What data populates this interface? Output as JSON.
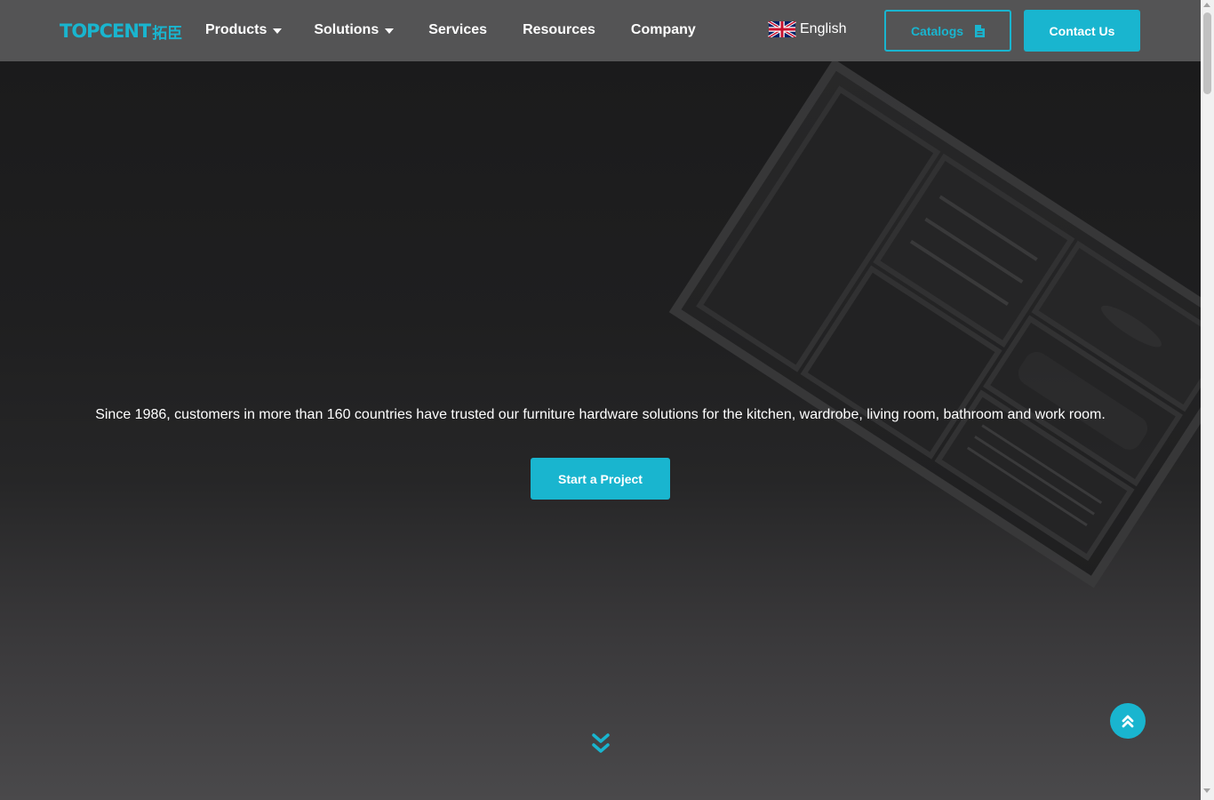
{
  "header": {
    "logo_text": "TOPCENT",
    "logo_text_cn": "拓臣",
    "nav": [
      {
        "label": "Products",
        "dropdown": true
      },
      {
        "label": "Solutions",
        "dropdown": true
      },
      {
        "label": "Services",
        "dropdown": false
      },
      {
        "label": "Resources",
        "dropdown": false
      },
      {
        "label": "Company",
        "dropdown": false
      }
    ],
    "language": {
      "label": "English",
      "icon": "uk-flag-icon"
    },
    "catalogs_label": "Catalogs",
    "catalogs_icon": "document-icon",
    "contact_label": "Contact Us"
  },
  "hero": {
    "tagline": "Since 1986, customers in more than 160 countries have trusted our furniture hardware solutions for the kitchen, wardrobe, living room, bathroom and work room.",
    "cta_label": "Start a Project",
    "scroll_icon": "double-chevron-down-icon"
  },
  "back_to_top_icon": "double-chevron-up-icon",
  "colors": {
    "accent": "#19b5cf",
    "header_bg": "#545455",
    "hero_bg": "#1b1b1c"
  }
}
